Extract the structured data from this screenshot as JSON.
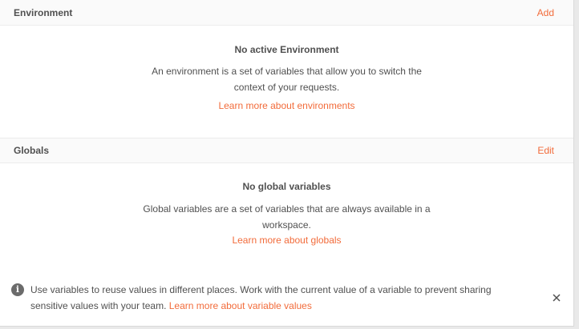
{
  "environment": {
    "title": "Environment",
    "action_label": "Add",
    "empty_title": "No active Environment",
    "empty_description": "An environment is a set of variables that allow you to switch the context of your requests.",
    "learn_more_label": "Learn more about environments"
  },
  "globals": {
    "title": "Globals",
    "action_label": "Edit",
    "empty_title": "No global variables",
    "empty_description": "Global variables are a set of variables that are always available in a workspace.",
    "learn_more_label": "Learn more about globals"
  },
  "info_banner": {
    "icon": "info-icon",
    "text": "Use variables to reuse values in different places. Work with the current value of a variable to prevent sharing sensitive values with your team.",
    "link_label": "Learn more about variable values",
    "close_icon": "close-icon"
  },
  "colors": {
    "accent": "#f26b3a",
    "text": "#505050",
    "header_bg": "#fafafa"
  }
}
